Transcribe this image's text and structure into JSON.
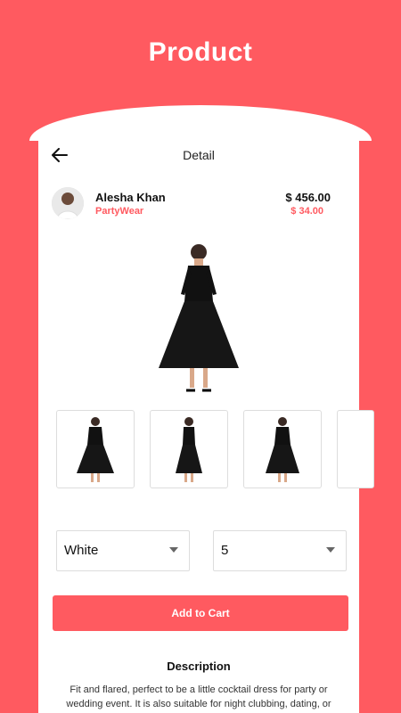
{
  "banner": {
    "title": "Product"
  },
  "header": {
    "title": "Detail",
    "back_icon": "arrow-left-icon"
  },
  "seller": {
    "name": "Alesha Khan",
    "category": "PartyWear"
  },
  "pricing": {
    "price": "$ 456.00",
    "secondary_price": "$ 34.00"
  },
  "options": {
    "color": {
      "selected": "White"
    },
    "size": {
      "selected": "5"
    }
  },
  "cart": {
    "add_label": "Add to Cart"
  },
  "description": {
    "title": "Description",
    "text": "Fit and flared, perfect to be a little cocktail dress for party or wedding event. It is also suitable for night clubbing, dating, or"
  },
  "colors": {
    "accent": "#FF5A60"
  }
}
